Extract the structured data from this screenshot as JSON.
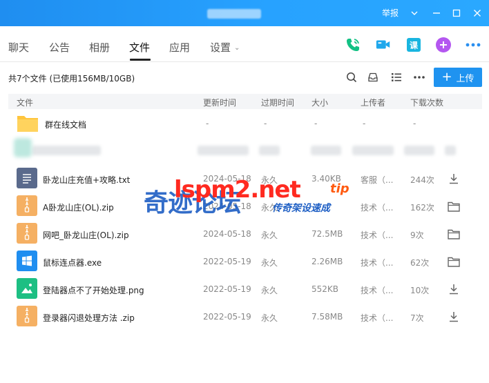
{
  "titlebar": {
    "report_label": "举报"
  },
  "tabs": [
    {
      "label": "聊天"
    },
    {
      "label": "公告"
    },
    {
      "label": "相册"
    },
    {
      "label": "文件"
    },
    {
      "label": "应用"
    },
    {
      "label": "设置"
    }
  ],
  "toolbar": {
    "summary": "共7个文件 (已使用156MB/10GB)",
    "upload_label": "上传",
    "lesson_icon_text": "课"
  },
  "columns": {
    "name": "文件",
    "updated": "更新时间",
    "expiry": "过期时间",
    "size": "大小",
    "uploader": "上传者",
    "downloads": "下载次数"
  },
  "folder_row": {
    "name": "群在线文档",
    "updated": "-",
    "expiry": "-",
    "size": "-",
    "uploader": "-",
    "downloads": "-"
  },
  "files": [
    {
      "name": "卧龙山庄充值+攻略.txt",
      "updated": "2024-05-18",
      "expiry": "永久",
      "size": "3.40KB",
      "uploader": "客服（...",
      "downloads": "244次",
      "icon": "txt-file-icon",
      "action": "download"
    },
    {
      "name": "A卧龙山庄(OL).zip",
      "updated": "2024-05-18",
      "expiry": "永久",
      "size": "",
      "uploader": "技术（...",
      "downloads": "162次",
      "icon": "zip-file-icon",
      "action": "folder"
    },
    {
      "name": "网吧_卧龙山庄(OL).zip",
      "updated": "2024-05-18",
      "expiry": "永久",
      "size": "72.5MB",
      "uploader": "技术（...",
      "downloads": "9次",
      "icon": "zip-file-icon",
      "action": "folder"
    },
    {
      "name": "鼠标连点器.exe",
      "updated": "2022-05-19",
      "expiry": "永久",
      "size": "2.26MB",
      "uploader": "技术（...",
      "downloads": "62次",
      "icon": "exe-file-icon",
      "action": "folder"
    },
    {
      "name": "登陆器点不了开始处理.png",
      "updated": "2022-05-19",
      "expiry": "永久",
      "size": "552KB",
      "uploader": "技术（...",
      "downloads": "10次",
      "icon": "image-file-icon",
      "action": "download"
    },
    {
      "name": "登录器闪退处理方法 .zip",
      "updated": "2022-05-19",
      "expiry": "永久",
      "size": "7.58MB",
      "uploader": "技术（...",
      "downloads": "7次",
      "icon": "zip-file-icon",
      "action": "download"
    }
  ],
  "watermark": {
    "cn": "奇迹论坛",
    "en": "lspm2.net",
    "tip": "tip",
    "sub": "传奇架设速成"
  },
  "colors": {
    "brand_blue": "#1f93f0",
    "folder_yellow": "#ffc53d",
    "zip_orange": "#f5b063",
    "txt_slate": "#5a6a8c",
    "exe_blue": "#1f8ef0",
    "image_green": "#1dbf83",
    "watermark_red": "#ff2a20",
    "watermark_blue": "#1d5ec4"
  }
}
